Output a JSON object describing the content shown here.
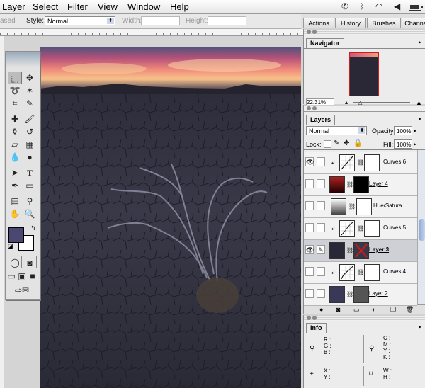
{
  "menubar": {
    "items": [
      "Layer",
      "Select",
      "Filter",
      "View",
      "Window",
      "Help"
    ],
    "status_icons": [
      "phone-icon",
      "bluetooth-icon",
      "wifi-icon",
      "volume-icon",
      "battery-icon"
    ]
  },
  "options": {
    "partial_label": "ased",
    "style_label": "Style:",
    "style_value": "Normal",
    "width_label": "Width:",
    "height_label": "Height:"
  },
  "palette_well": {
    "tabs": [
      "Actions",
      "History",
      "Brushes",
      "Channe"
    ]
  },
  "navigator": {
    "title": "Navigator",
    "zoom": "22.31%"
  },
  "layers": {
    "title": "Layers",
    "blend_mode": "Normal",
    "opacity_label": "Opacity:",
    "opacity_value": "100%",
    "lock_label": "Lock:",
    "fill_label": "Fill:",
    "fill_value": "100%",
    "rows": [
      {
        "name": "Curves 6",
        "visible": true,
        "active": false,
        "linked_style": false
      },
      {
        "name": "Layer 4",
        "visible": false,
        "active": false,
        "linked_style": true
      },
      {
        "name": "Hue/Satura...",
        "visible": false,
        "active": false,
        "linked_style": false
      },
      {
        "name": "Curves 5",
        "visible": false,
        "active": false,
        "linked_style": false
      },
      {
        "name": "Layer 3",
        "visible": true,
        "active": true,
        "linked_style": true
      },
      {
        "name": "Curves 4",
        "visible": false,
        "active": false,
        "linked_style": false
      },
      {
        "name": "Layer 2",
        "visible": false,
        "active": false,
        "linked_style": true
      }
    ]
  },
  "info": {
    "title": "Info",
    "labels_rgb": [
      "R :",
      "G :",
      "B :"
    ],
    "labels_cmyk": [
      "C :",
      "M :",
      "Y :",
      "K :"
    ],
    "labels_xy": [
      "X :",
      "Y :"
    ],
    "labels_wh": [
      "W :",
      "H :"
    ]
  },
  "colors": {
    "foreground": "#4a4870",
    "background": "#ffffff",
    "accent_nav_frame": "#d11a1a"
  }
}
